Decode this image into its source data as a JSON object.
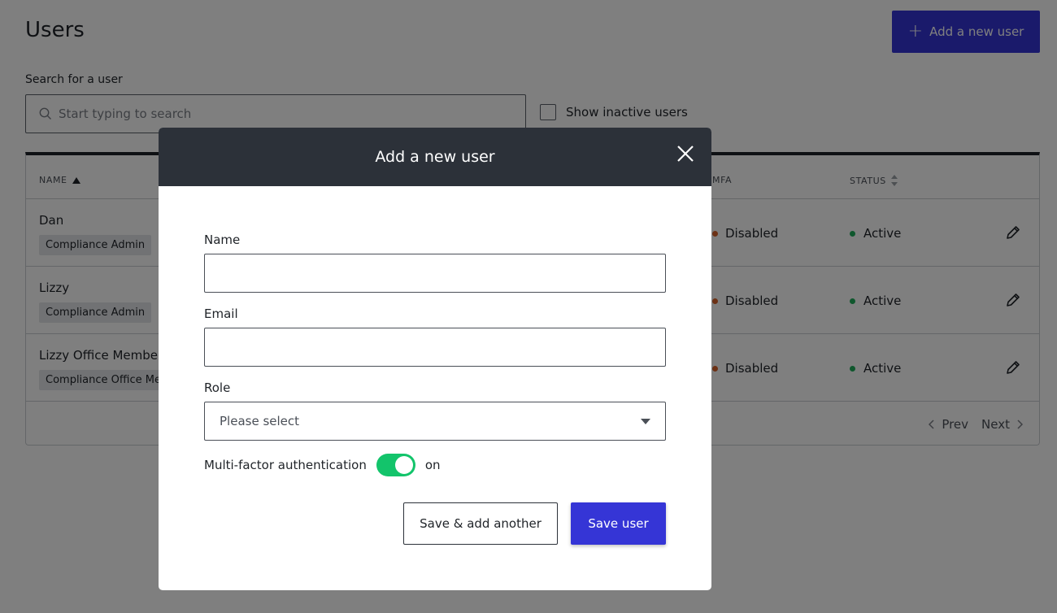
{
  "page": {
    "title": "Users",
    "add_button_label": "Add a new user",
    "search_label": "Search for a user",
    "search_placeholder": "Start typing to search",
    "show_inactive_label": "Show inactive users"
  },
  "table": {
    "columns": {
      "name": "NAME",
      "mfa": "MFA",
      "status": "STATUS"
    },
    "rows": [
      {
        "name": "Dan",
        "role": "Compliance Admin",
        "mfa": "Disabled",
        "status": "Active"
      },
      {
        "name": "Lizzy",
        "role": "Compliance Admin",
        "mfa": "Disabled",
        "status": "Active"
      },
      {
        "name": "Lizzy Office Member",
        "role": "Compliance Office Member",
        "mfa": "Disabled",
        "status": "Active"
      }
    ],
    "pager": {
      "prev": "Prev",
      "next": "Next"
    }
  },
  "modal": {
    "title": "Add a new user",
    "name_label": "Name",
    "name_value": "",
    "email_label": "Email",
    "email_value": "",
    "role_label": "Role",
    "role_value": "Please select",
    "mfa_label": "Multi-factor authentication",
    "mfa_state": "on",
    "save_another_label": "Save & add another",
    "save_label": "Save user"
  },
  "colors": {
    "primary": "#3535d6",
    "header_dark": "#2c3139",
    "toggle_on": "#13c46b",
    "status_active": "#1fae5b",
    "mfa_disabled": "#d9622b"
  }
}
